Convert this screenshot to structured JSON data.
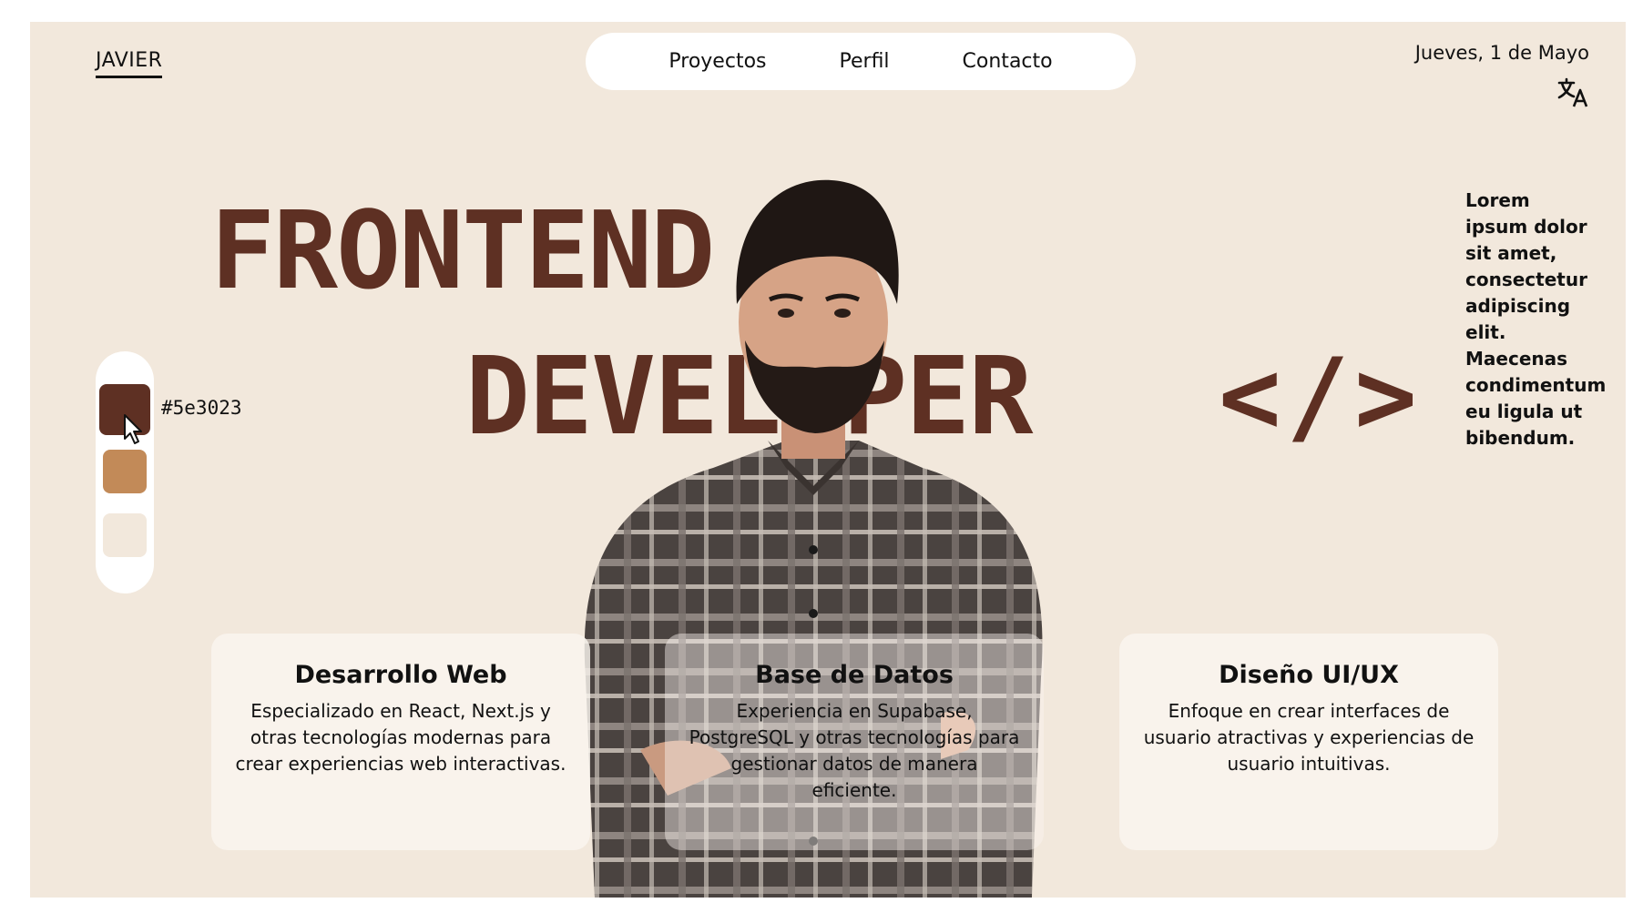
{
  "header": {
    "brand": "JAVIER",
    "nav": [
      {
        "label": "Proyectos"
      },
      {
        "label": "Perfil"
      },
      {
        "label": "Contacto"
      }
    ],
    "date": "Jueves, 1 de Mayo",
    "translate_icon": "translate-icon"
  },
  "hero": {
    "line1": "FRONTEND",
    "line2": "DEVELOPER",
    "code": "</>"
  },
  "side_text": "Lorem ipsum dolor sit amet, consectetur adipiscing elit. Maecenas condimentum eu ligula ut bibendum.",
  "color_picker": {
    "selected_hex": "#5e3023",
    "swatches": [
      "#5e3023",
      "#c28a58",
      "#f2e8dc"
    ]
  },
  "cards": [
    {
      "title": "Desarrollo Web",
      "description": "Especializado en React, Next.js y otras tecnologías modernas para crear experiencias web interactivas."
    },
    {
      "title": "Base de Datos",
      "description": "Experiencia en Supabase, PostgreSQL y otras tecnologías para gestionar datos de manera eficiente."
    },
    {
      "title": "Diseño UI/UX",
      "description": "Enfoque en crear interfaces de usuario atractivas y experiencias de usuario intuitivas."
    }
  ],
  "colors": {
    "accent": "#5e3023",
    "background": "#f2e8dc",
    "card": "#faf5ef"
  }
}
